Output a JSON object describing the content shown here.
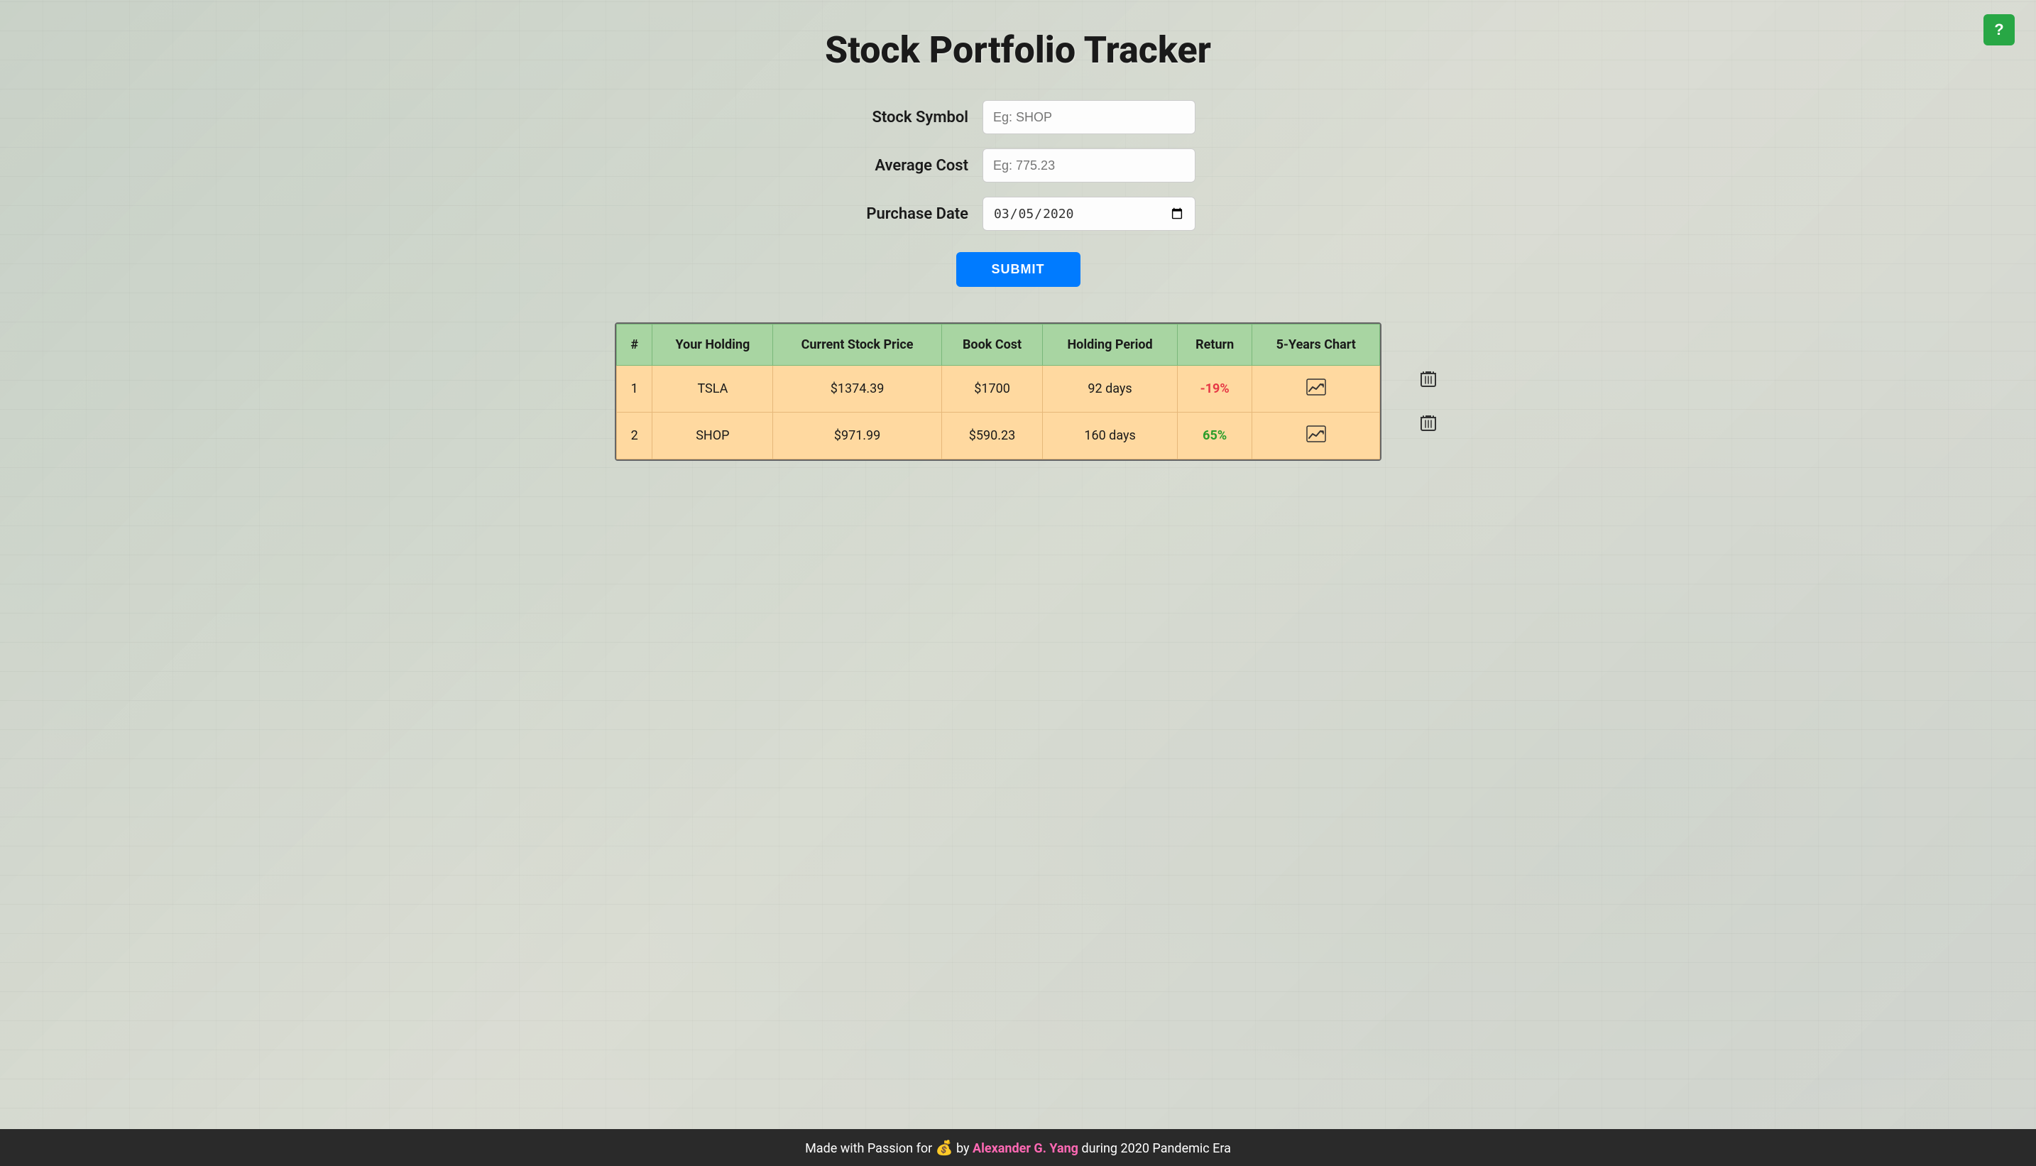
{
  "page": {
    "title": "Stock Portfolio Tracker",
    "help_button": "?"
  },
  "form": {
    "stock_symbol_label": "Stock Symbol",
    "stock_symbol_placeholder": "Eg: SHOP",
    "average_cost_label": "Average Cost",
    "average_cost_placeholder": "Eg: 775.23",
    "purchase_date_label": "Purchase Date",
    "purchase_date_value": "2020-03-05",
    "submit_label": "SUBMIT"
  },
  "table": {
    "headers": {
      "num": "#",
      "holding": "Your Holding",
      "stock_price": "Current Stock Price",
      "book_cost": "Book Cost",
      "holding_period": "Holding Period",
      "return": "Return",
      "chart": "5-Years Chart"
    },
    "rows": [
      {
        "num": "1",
        "holding": "TSLA",
        "stock_price": "$1374.39",
        "book_cost": "$1700",
        "holding_period": "92 days",
        "return": "-19%",
        "return_type": "negative",
        "chart_icon": "📈"
      },
      {
        "num": "2",
        "holding": "SHOP",
        "stock_price": "$971.99",
        "book_cost": "$590.23",
        "holding_period": "160 days",
        "return": "65%",
        "return_type": "positive",
        "chart_icon": "📈"
      }
    ]
  },
  "footer": {
    "text_before": "Made with Passion for",
    "emoji": "💰",
    "text_by": "by",
    "author": "Alexander G. Yang",
    "text_after": "during 2020 Pandemic Era"
  }
}
